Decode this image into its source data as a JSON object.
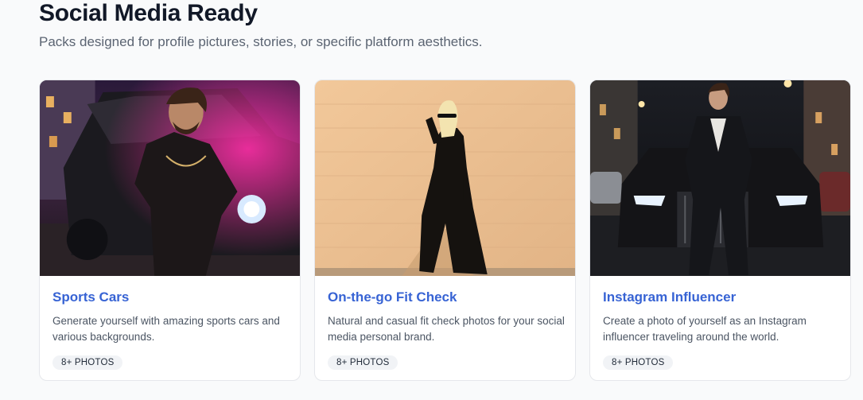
{
  "section": {
    "title": "Social Media Ready",
    "subtitle": "Packs designed for profile pictures, stories, or specific platform aesthetics."
  },
  "cards": [
    {
      "title": "Sports Cars",
      "description": "Generate yourself with amazing sports cars and various backgrounds.",
      "badge": "8+ PHOTOS",
      "image": "man-leaning-on-black-suv-pink-neon"
    },
    {
      "title": "On-the-go Fit Check",
      "description": "Natural and casual fit check photos for your social media personal brand.",
      "badge": "8+ PHOTOS",
      "image": "woman-black-dress-sunglasses-beige-wall"
    },
    {
      "title": "Instagram Influencer",
      "description": "Create a photo of yourself as an Instagram influencer traveling around the world.",
      "badge": "8+ PHOTOS",
      "image": "man-in-suit-on-luxury-car-night-street"
    }
  ],
  "colors": {
    "accent": "#3763d4",
    "background": "#f9fafb",
    "card": "#ffffff"
  }
}
